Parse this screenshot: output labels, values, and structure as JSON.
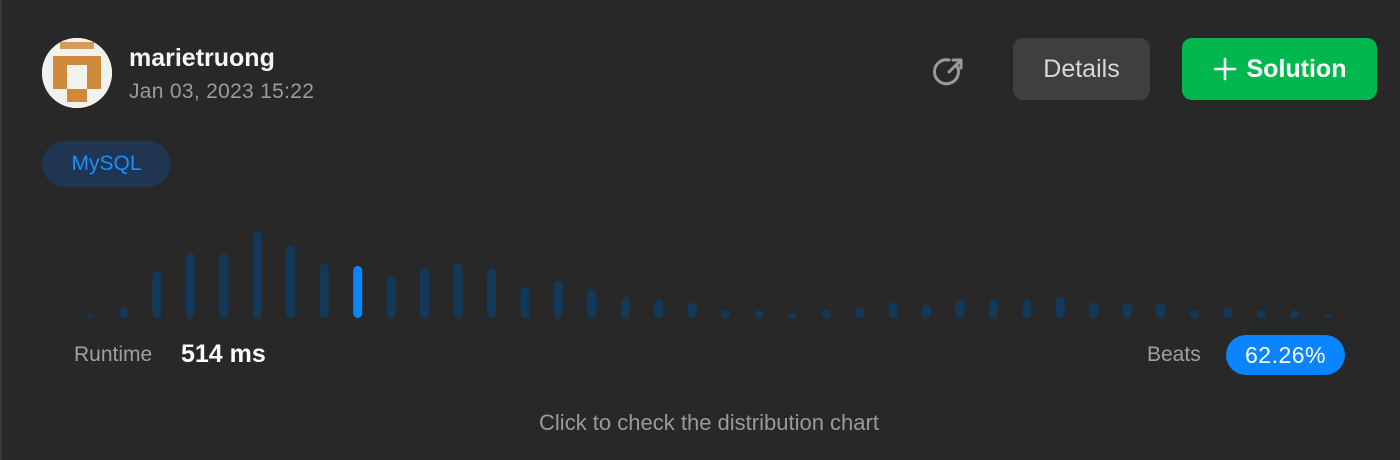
{
  "user": {
    "name": "marietruong",
    "timestamp": "Jan 03, 2023 15:22",
    "avatar_icon": "pixel-avatar-icon"
  },
  "toolbar": {
    "share_icon": "share-arrow-icon",
    "details_label": "Details",
    "solution_label": "Solution",
    "solution_icon": "plus-icon"
  },
  "tag": {
    "label": "MySQL"
  },
  "stats": {
    "runtime_label": "Runtime",
    "runtime_value": "514 ms",
    "beats_label": "Beats",
    "beats_value": "62.26%"
  },
  "footer": {
    "link_text": "Click to check the distribution chart"
  },
  "colors": {
    "background": "#282828",
    "bar": "#12395a",
    "bar_highlight": "#0a84ff",
    "success": "#02b74e",
    "accent": "#0a84ff"
  },
  "chart_data": {
    "type": "bar",
    "title": "",
    "xlabel": "",
    "ylabel": "",
    "highlight_index": 8,
    "values": [
      1,
      4,
      18,
      25,
      25,
      33,
      28,
      21,
      20,
      16,
      19,
      21,
      19,
      12,
      14,
      11,
      8,
      7,
      6,
      3,
      3,
      2,
      3,
      4,
      6,
      5,
      7,
      7,
      7,
      8,
      6,
      6,
      6,
      3,
      4,
      3,
      3,
      1
    ]
  }
}
